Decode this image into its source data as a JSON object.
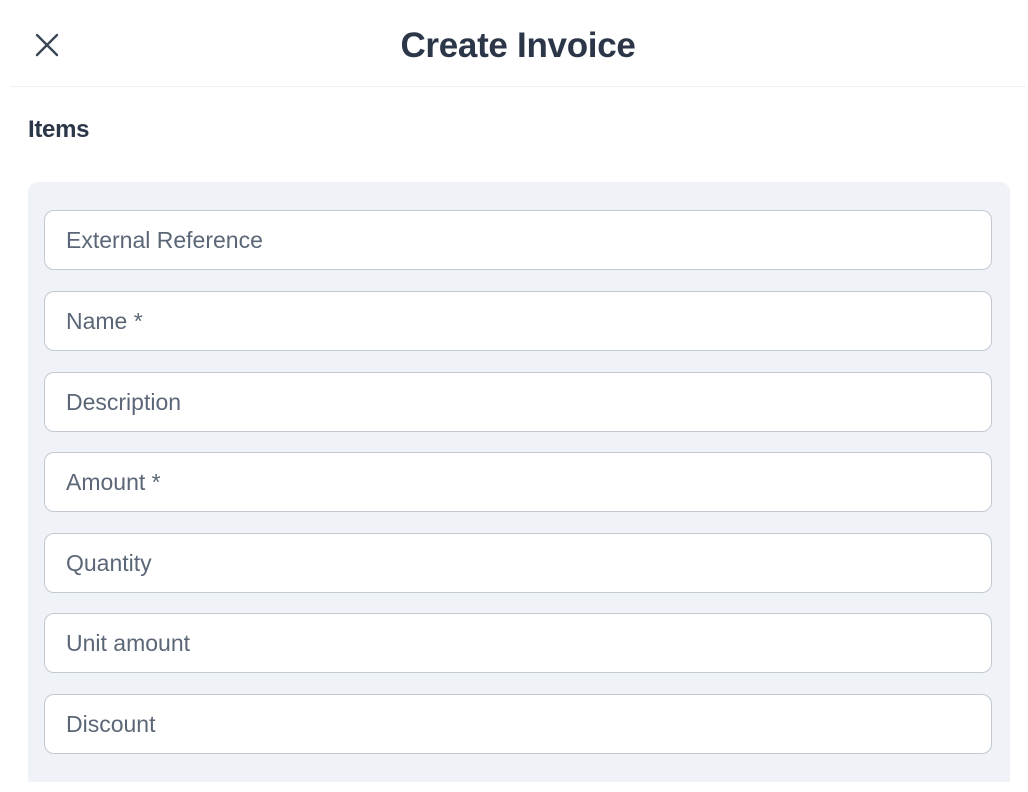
{
  "header": {
    "title": "Create Invoice",
    "close_icon": "close-icon"
  },
  "section": {
    "label": "Items"
  },
  "fields": {
    "external_reference": {
      "placeholder": "External Reference",
      "value": ""
    },
    "name": {
      "placeholder": "Name *",
      "value": ""
    },
    "description": {
      "placeholder": "Description",
      "value": ""
    },
    "amount": {
      "placeholder": "Amount *",
      "value": ""
    },
    "quantity": {
      "placeholder": "Quantity",
      "value": ""
    },
    "unit_amount": {
      "placeholder": "Unit amount",
      "value": ""
    },
    "discount": {
      "placeholder": "Discount",
      "value": ""
    }
  },
  "colors": {
    "title_text": "#2b3748",
    "panel_background": "#eff2f6",
    "field_border": "#c3c9d1",
    "placeholder_text": "#5b6777"
  }
}
